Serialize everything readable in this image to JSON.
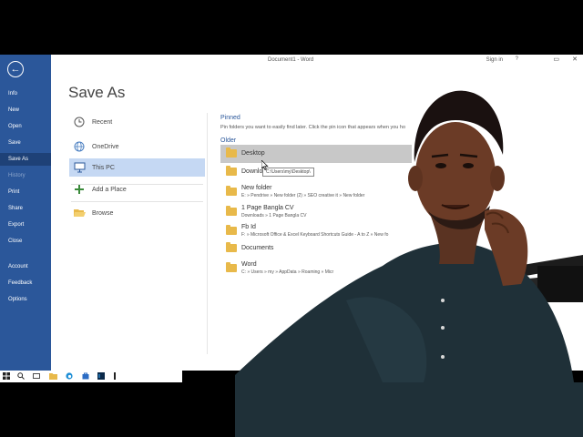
{
  "window": {
    "doc_title": "Document1  -  Word",
    "signin": "Sign in",
    "help": "?",
    "minimize": "▭",
    "close": "✕"
  },
  "nav": {
    "back": "←",
    "items": [
      {
        "label": "Info"
      },
      {
        "label": "New"
      },
      {
        "label": "Open"
      },
      {
        "label": "Save"
      },
      {
        "label": "Save As"
      },
      {
        "label": "History"
      },
      {
        "label": "Print"
      },
      {
        "label": "Share"
      },
      {
        "label": "Export"
      },
      {
        "label": "Close"
      },
      {
        "label": "Account"
      },
      {
        "label": "Feedback"
      },
      {
        "label": "Options"
      }
    ]
  },
  "main": {
    "heading": "Save As",
    "locations": [
      {
        "label": "Recent",
        "icon": "clock-icon"
      },
      {
        "label": "OneDrive",
        "icon": "globe-icon"
      },
      {
        "label": "This PC",
        "icon": "monitor-icon"
      },
      {
        "label": "Add a Place",
        "icon": "plus-icon"
      },
      {
        "label": "Browse",
        "icon": "folder-open-icon"
      }
    ],
    "pinned_head": "Pinned",
    "pinned_desc": "Pin folders you want to easily find later. Click the pin icon that appears when you ho",
    "older_head": "Older",
    "folders": [
      {
        "name": "Desktop",
        "path": ""
      },
      {
        "name": "Downlo",
        "path": ""
      },
      {
        "name": "New folder",
        "path": "E: » Pendrive » New folder (2) » SEO creative it » New folder"
      },
      {
        "name": "1 Page Bangla CV",
        "path": "Downloads » 1 Page Bangla CV"
      },
      {
        "name": "Fb Id",
        "path": "F: » Microsoft Office & Excel Keyboard Shortcuts Guide -  A to Z » New fo"
      },
      {
        "name": "Documents",
        "path": ""
      },
      {
        "name": "Word",
        "path": "C: » Users » my » AppData » Roaming » Micr"
      }
    ],
    "tooltip": "C:\\Users\\my\\Desktop\\"
  },
  "taskbar": {
    "items": [
      "start-icon",
      "search-icon",
      "task-view-icon",
      "file-explorer-icon",
      "edge-icon",
      "store-icon",
      "photoshop-icon",
      "app-icon"
    ],
    "start": "⊞",
    "search": "⌕"
  },
  "colors": {
    "nav_bg": "#2b579a",
    "nav_active": "#1e4177",
    "selected_location": "#c5d8f3",
    "folder_icon": "#e8b94a",
    "accent": "#2b579a"
  }
}
